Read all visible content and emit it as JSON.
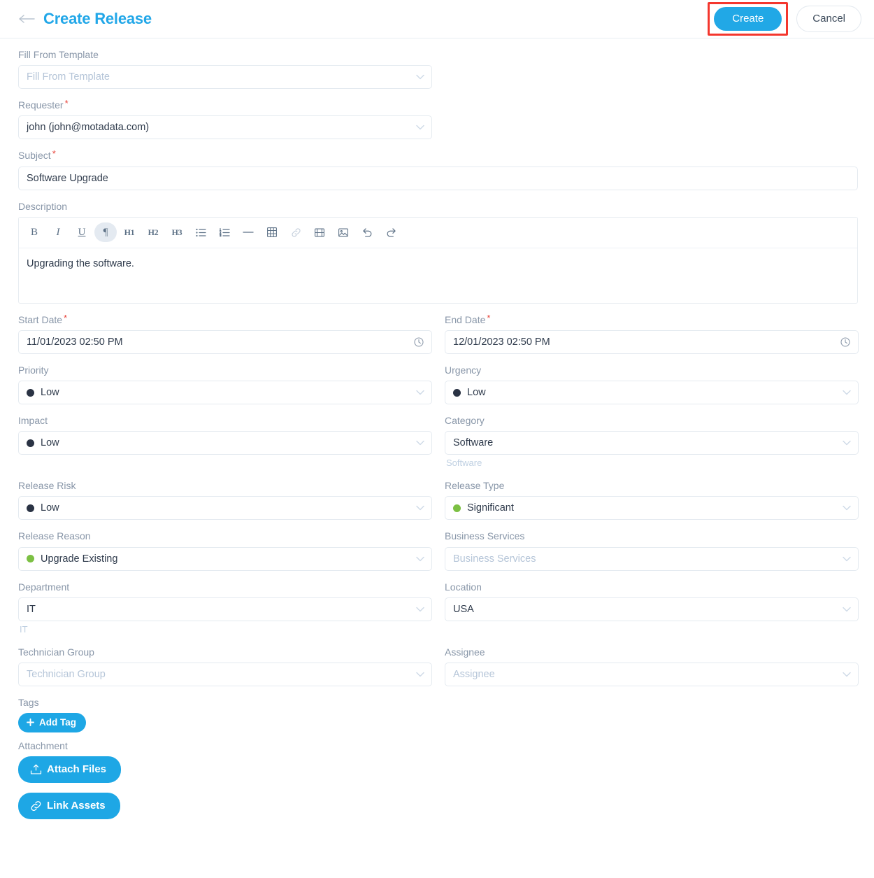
{
  "header": {
    "back_icon": "arrow-left-icon",
    "title": "Create Release",
    "create_label": "Create",
    "cancel_label": "Cancel",
    "highlight_color": "#f4372e",
    "accent_color": "#21a8e6"
  },
  "form": {
    "template": {
      "label": "Fill From Template",
      "placeholder": "Fill From Template",
      "value": ""
    },
    "requester": {
      "label": "Requester",
      "required": true,
      "value": "john (john@motadata.com)"
    },
    "subject": {
      "label": "Subject",
      "required": true,
      "value": "Software Upgrade"
    },
    "description": {
      "label": "Description",
      "value": "Upgrading the software.",
      "toolbar": [
        {
          "name": "bold-icon",
          "glyph": "B",
          "style": "bold",
          "active": false
        },
        {
          "name": "italic-icon",
          "glyph": "I",
          "style": "italic",
          "active": false
        },
        {
          "name": "underline-icon",
          "glyph": "U",
          "style": "underline",
          "active": false
        },
        {
          "name": "paragraph-icon",
          "glyph": "¶",
          "style": "normal",
          "active": true
        },
        {
          "name": "heading-1-icon",
          "glyph": "H1",
          "style": "small",
          "active": false
        },
        {
          "name": "heading-2-icon",
          "glyph": "H2",
          "style": "small",
          "active": false
        },
        {
          "name": "heading-3-icon",
          "glyph": "H3",
          "style": "small",
          "active": false
        },
        {
          "name": "bullet-list-icon",
          "glyph": "svg:bullet",
          "style": "svg",
          "active": false
        },
        {
          "name": "numbered-list-icon",
          "glyph": "svg:ordered",
          "style": "svg",
          "active": false
        },
        {
          "name": "horizontal-rule-icon",
          "glyph": "svg:hr",
          "style": "svg",
          "active": false
        },
        {
          "name": "table-icon",
          "glyph": "svg:table",
          "style": "svg",
          "active": false
        },
        {
          "name": "link-icon",
          "glyph": "svg:link",
          "style": "svg-muted",
          "active": false
        },
        {
          "name": "video-icon",
          "glyph": "svg:video",
          "style": "svg",
          "active": false
        },
        {
          "name": "image-icon",
          "glyph": "svg:image",
          "style": "svg",
          "active": false
        },
        {
          "name": "undo-icon",
          "glyph": "svg:undo",
          "style": "svg",
          "active": false
        },
        {
          "name": "redo-icon",
          "glyph": "svg:redo",
          "style": "svg",
          "active": false
        }
      ]
    },
    "start_date": {
      "label": "Start Date",
      "required": true,
      "value": "11/01/2023 02:50 PM",
      "icon": "clock-icon"
    },
    "end_date": {
      "label": "End Date",
      "required": true,
      "value": "12/01/2023 02:50 PM",
      "icon": "clock-icon"
    },
    "priority": {
      "label": "Priority",
      "value": "Low",
      "dot": "#2a3344"
    },
    "urgency": {
      "label": "Urgency",
      "value": "Low",
      "dot": "#2a3344"
    },
    "impact": {
      "label": "Impact",
      "value": "Low",
      "dot": "#2a3344"
    },
    "category": {
      "label": "Category",
      "value": "Software",
      "hint": "Software"
    },
    "release_risk": {
      "label": "Release Risk",
      "value": "Low",
      "dot": "#2a3344"
    },
    "release_type": {
      "label": "Release Type",
      "value": "Significant",
      "dot": "#7cc043"
    },
    "release_reason": {
      "label": "Release Reason",
      "value": "Upgrade Existing",
      "dot": "#7cc043"
    },
    "business_services": {
      "label": "Business Services",
      "placeholder": "Business Services",
      "value": ""
    },
    "department": {
      "label": "Department",
      "value": "IT",
      "hint": "IT"
    },
    "location": {
      "label": "Location",
      "value": "USA"
    },
    "technician_group": {
      "label": "Technician Group",
      "placeholder": "Technician Group",
      "value": ""
    },
    "assignee": {
      "label": "Assignee",
      "placeholder": "Assignee",
      "value": ""
    },
    "tags": {
      "label": "Tags",
      "add_label": "Add Tag",
      "add_icon": "plus-icon"
    },
    "attachment": {
      "label": "Attachment",
      "attach_label": "Attach Files",
      "attach_icon": "upload-icon",
      "link_label": "Link Assets",
      "link_icon": "chain-link-icon"
    }
  }
}
